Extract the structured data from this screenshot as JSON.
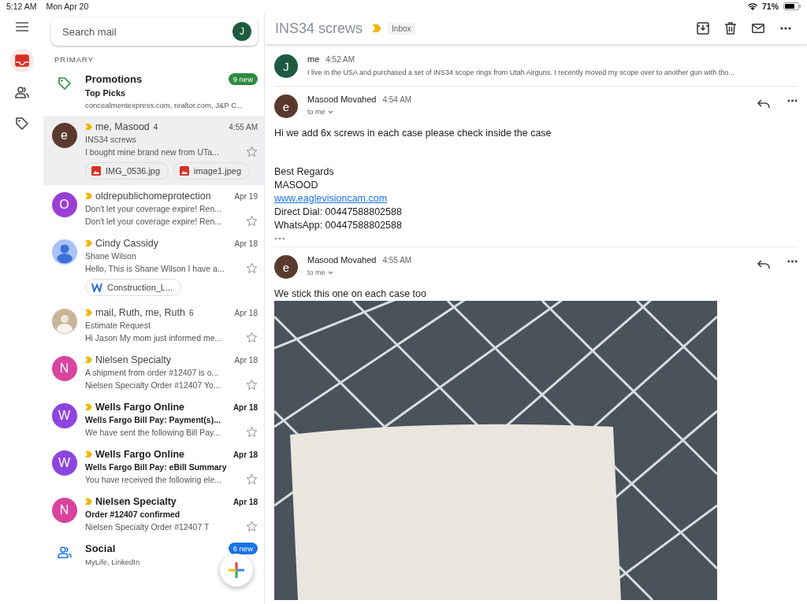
{
  "status_bar": {
    "time": "5:12 AM",
    "date": "Mon Apr 20",
    "battery": "71%"
  },
  "rail": [
    {
      "kind": "inbox",
      "selected": true
    },
    {
      "kind": "people",
      "selected": false
    },
    {
      "kind": "tag",
      "selected": false
    }
  ],
  "search": {
    "placeholder": "Search mail",
    "avatar": "J"
  },
  "section": "PRIMARY",
  "mail_list": [
    {
      "kind": "promotions",
      "title": "Promotions",
      "badge": "9 new",
      "color": "#2e8b3e",
      "subtitle": "Top Picks",
      "snippet": "concealmentexpress.com, realtor.com, J&P C..."
    },
    {
      "kind": "lettered",
      "avatar": "e",
      "color": "#5b3a2e",
      "important": true,
      "sender": "me, Masood",
      "count": "4",
      "time": "4:55 AM",
      "subject": "INS34 screws",
      "snippet": "I bought mine brand new from UTa...",
      "unread": false,
      "selected": true,
      "starred": false,
      "attachments": [
        {
          "kind": "image",
          "name": "IMG_0536.jpg"
        },
        {
          "kind": "image",
          "name": "image1.jpeg"
        }
      ]
    },
    {
      "kind": "lettered",
      "avatar": "O",
      "color": "#9a3fd6",
      "important": true,
      "sender": "oldrepublichomeprotection",
      "time": "Apr 19",
      "subject": "Don't let your coverage expire! Ren...",
      "snippet": "Don't let your coverage expire! Ren...",
      "unread": false,
      "selected": false,
      "starred": false
    },
    {
      "kind": "silhouette",
      "color": "#a8c3f5",
      "important": true,
      "sender": "Cindy Cassidy",
      "time": "Apr 18",
      "subject": "Shane Wilson",
      "snippet": "Hello, This is Shane Wilson I have a...",
      "unread": false,
      "selected": false,
      "starred": false,
      "attachments": [
        {
          "kind": "word",
          "name": "Construction_L..."
        }
      ]
    },
    {
      "kind": "photo",
      "color": "#c9b59a",
      "important": true,
      "sender": "mail, Ruth, me, Ruth",
      "count": "6",
      "time": "Apr 18",
      "subject": "Estimate Request",
      "snippet": "Hi Jason My mom just informed me...",
      "unread": false,
      "selected": false,
      "starred": false
    },
    {
      "kind": "lettered",
      "avatar": "N",
      "color": "#d9449e",
      "important": true,
      "sender": "Nielsen Specialty",
      "time": "Apr 18",
      "subject": "A shipment from order #12407 is o...",
      "snippet": "Nielsen Specialty Order #12407 Yo...",
      "unread": false,
      "selected": false,
      "starred": false
    },
    {
      "kind": "lettered",
      "avatar": "W",
      "color": "#8e44e0",
      "important": true,
      "sender": "Wells Fargo Online",
      "time": "Apr 18",
      "subject": "Wells Fargo Bill Pay: Payment(s)...",
      "snippet": "We have sent the following Bill Pay...",
      "unread": true,
      "selected": false,
      "starred": false
    },
    {
      "kind": "lettered",
      "avatar": "W",
      "color": "#8e44e0",
      "important": true,
      "sender": "Wells Fargo Online",
      "time": "Apr 18",
      "subject": "Wells Fargo Bill Pay: eBill Summary",
      "snippet": "You have received the following ele...",
      "unread": true,
      "selected": false,
      "starred": false
    },
    {
      "kind": "lettered",
      "avatar": "N",
      "color": "#d9449e",
      "important": true,
      "sender": "Nielsen Specialty",
      "time": "Apr 18",
      "subject": "Order #12407 confirmed",
      "snippet": "Nielsen Specialty Order #12407 T",
      "unread": true,
      "selected": false,
      "starred": false
    },
    {
      "kind": "social",
      "title": "Social",
      "badge": "6 new",
      "color": "#1a73e8",
      "snippet": "MyLife, LinkedIn"
    }
  ],
  "conversation": {
    "title": "INS34 screws",
    "important": true,
    "label": "Inbox",
    "messages": [
      {
        "kind": "collapsed",
        "avatar": "J",
        "color": "#1e5a43",
        "sender": "me",
        "time": "4:52 AM",
        "snippet": "I live in the USA and purchased a set of INS34 scope rings from Utah Airguns. I recently moved my scope over to another gun with tho..."
      },
      {
        "kind": "expanded",
        "avatar": "e",
        "color": "#5b3a2e",
        "sender": "Masood Movahed",
        "time": "4:54 AM",
        "recipient": "to me",
        "body": "Hi we add 6x screws in each case please check inside the case",
        "signature": [
          {
            "kind": "text",
            "text": "Best Regards"
          },
          {
            "kind": "text",
            "text": "MASOOD"
          },
          {
            "kind": "link",
            "text": "www.eaglevisioncam.com"
          },
          {
            "kind": "text",
            "text": "Direct Dial: 00447588802588"
          },
          {
            "kind": "text",
            "text": "WhatsApp: 00447588802588"
          }
        ],
        "trimmed": true,
        "photo": false
      },
      {
        "kind": "expanded",
        "avatar": "e",
        "color": "#5b3a2e",
        "sender": "Masood Movahed",
        "time": "4:55 AM",
        "recipient": "to me",
        "body": "We stick this one on each case too",
        "trimmed": false,
        "photo": true
      }
    ]
  }
}
